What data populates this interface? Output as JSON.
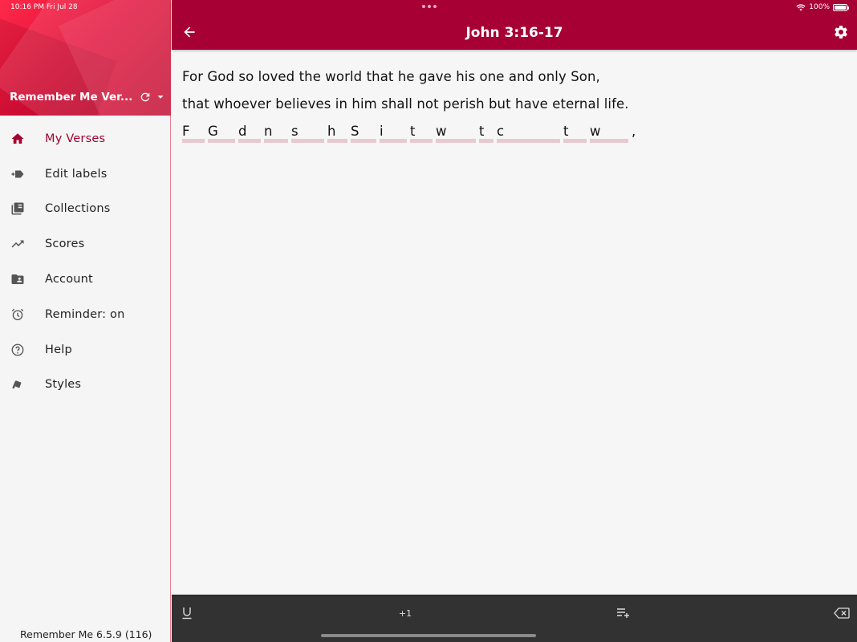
{
  "status_bar": {
    "time": "10:16 PM   Fri Jul 28",
    "battery": "100%"
  },
  "drawer": {
    "account_name": "Remember Me Ver...",
    "items": [
      {
        "label": "My Verses",
        "icon": "home-icon",
        "active": true
      },
      {
        "label": "Edit labels",
        "icon": "label-edit-icon",
        "active": false
      },
      {
        "label": "Collections",
        "icon": "collections-icon",
        "active": false
      },
      {
        "label": "Scores",
        "icon": "trending-icon",
        "active": false
      },
      {
        "label": "Account",
        "icon": "account-folder-icon",
        "active": false
      },
      {
        "label": "Reminder: on",
        "icon": "alarm-icon",
        "active": false
      },
      {
        "label": "Help",
        "icon": "help-icon",
        "active": false
      },
      {
        "label": "Styles",
        "icon": "styles-icon",
        "active": false
      }
    ],
    "version": "Remember Me 6.5.9 (116)"
  },
  "app_bar": {
    "title": "John 3:16-17"
  },
  "verse": {
    "lines": [
      "For God so loved the world that he gave his one and only Son,",
      "that whoever believes in him shall not perish but have eternal life."
    ],
    "hint_letters": [
      "F",
      "G",
      "d",
      "n",
      "s",
      "h",
      "S",
      "i",
      "t",
      "w",
      "t",
      "c",
      "t",
      "w"
    ],
    "hint_trailing": ","
  },
  "toolbar": {
    "underline_label": "U",
    "plus_one_label": "+1"
  },
  "colors": {
    "primary": "#a60035",
    "active_nav": "#a3032f",
    "hint_bar": "#e8c9d0",
    "toolbar_bg": "#323232"
  }
}
